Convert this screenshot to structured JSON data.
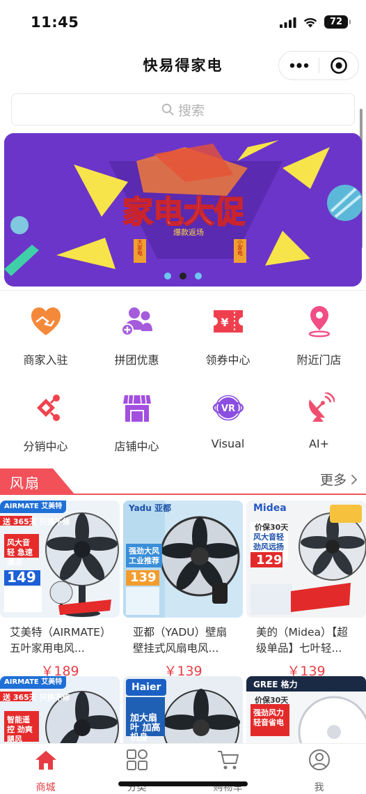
{
  "status_bar": {
    "time": "11:45",
    "battery": "72",
    "signal_icon": "cellular-signal-icon",
    "wifi_icon": "wifi-icon"
  },
  "nav": {
    "title": "快易得家电",
    "more_icon": "more-dots-icon",
    "close_icon": "target-close-icon"
  },
  "search": {
    "placeholder": "搜索",
    "icon": "search-icon"
  },
  "banner": {
    "headline": "家电大促",
    "subline": "爆款返场",
    "badge_left": "大家电",
    "badge_right": "小家电",
    "slides": 3,
    "active_slide": 2
  },
  "grid": [
    {
      "label": "商家入驻",
      "icon": "handshake-heart-icon",
      "color": "#f5893a"
    },
    {
      "label": "拼团优惠",
      "icon": "group-add-icon",
      "color": "#a45bdc"
    },
    {
      "label": "领券中心",
      "icon": "coupon-icon",
      "color": "#ef3f4f"
    },
    {
      "label": "附近门店",
      "icon": "location-pin-icon",
      "color": "#f24e86"
    },
    {
      "label": "分销中心",
      "icon": "share-distribution-icon",
      "color": "#f0424e"
    },
    {
      "label": "店铺中心",
      "icon": "store-icon",
      "color": "#a24fe0"
    },
    {
      "label": "Visual",
      "icon": "vr-icon",
      "color": "#8a4fe0"
    },
    {
      "label": "AI+",
      "icon": "satellite-dish-icon",
      "color": "#ef4f6f"
    }
  ],
  "section": {
    "title": "风扇",
    "more": "更多",
    "more_icon": "chevron-right-icon"
  },
  "products": [
    {
      "name": "艾美特（AIRMATE）五叶家用电风...",
      "price": "￥189",
      "brand": "AIRMATE 艾美特",
      "promo": "送 365天 只换不修",
      "feature": "风大音轻 急速清凉",
      "shown_price": "149"
    },
    {
      "name": "亚都（YADU）壁扇 壁挂式风扇电风...",
      "price": "￥139",
      "brand": "Yadu 亚都",
      "promo": "",
      "feature": "强劲大风 工业推荐",
      "shown_price": "139"
    },
    {
      "name": "美的（Midea）【超级单品】七叶轻...",
      "price": "￥139",
      "brand": "Midea",
      "promo": "价保30天",
      "feature": "风大音轻 劲风远扬",
      "shown_price": "129"
    },
    {
      "name": "",
      "price": "",
      "brand": "AIRMATE 艾美特",
      "promo": "送 365天 只换不修",
      "feature": "智能遥控 劲爽飓风",
      "shown_price": ""
    },
    {
      "name": "",
      "price": "",
      "brand": "Haier",
      "promo": "",
      "feature": "加大扇叶 加高机身",
      "shown_price": ""
    },
    {
      "name": "",
      "price": "",
      "brand": "GREE 格力",
      "promo": "价保30天",
      "feature": "强劲风力 轻音省电",
      "shown_price": ""
    }
  ],
  "tabbar": [
    {
      "label": "商城",
      "icon": "home-icon",
      "active": true
    },
    {
      "label": "分类",
      "icon": "category-grid-icon",
      "active": false
    },
    {
      "label": "购物车",
      "icon": "shopping-cart-icon",
      "active": false
    },
    {
      "label": "我",
      "icon": "user-profile-icon",
      "active": false
    }
  ],
  "colors": {
    "accent": "#e73c45",
    "banner_bg": "#6b35c9"
  }
}
